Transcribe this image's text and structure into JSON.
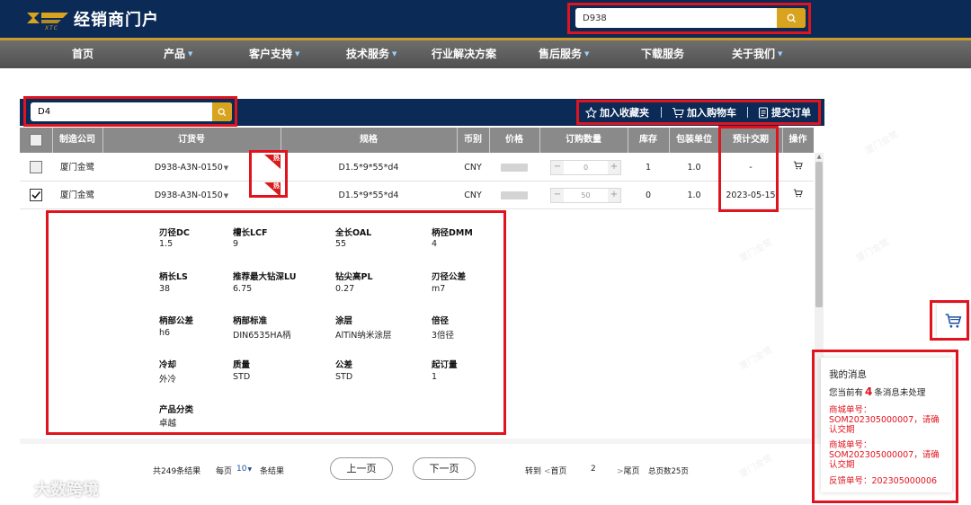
{
  "header": {
    "logo_text": "XTC",
    "portal_title": "经销商门户",
    "search_value": "D938",
    "search_icon": "search-icon"
  },
  "nav": [
    {
      "label": "首页",
      "dropdown": false
    },
    {
      "label": "产品",
      "dropdown": true
    },
    {
      "label": "客户支持",
      "dropdown": true
    },
    {
      "label": "技术服务",
      "dropdown": true
    },
    {
      "label": "行业解决方案",
      "dropdown": false
    },
    {
      "label": "售后服务",
      "dropdown": true
    },
    {
      "label": "下载服务",
      "dropdown": false
    },
    {
      "label": "关于我们",
      "dropdown": true
    }
  ],
  "panel": {
    "code_search_value": "D4",
    "actions": {
      "favorite": "加入收藏夹",
      "cart": "加入购物车",
      "submit": "提交订单"
    }
  },
  "table": {
    "columns": [
      "制造公司",
      "订货号",
      "规格",
      "币别",
      "价格",
      "订购数量",
      "库存",
      "包装单位",
      "预计交期",
      "操作"
    ],
    "rows": [
      {
        "checked": false,
        "maker": "厦门金鹭",
        "order_no": "D938-A3N-0150",
        "spec": "D1.5*9*55*d4",
        "currency": "CNY",
        "qty": "0",
        "stock": "1",
        "pack": "1.0",
        "delivery": "-",
        "flag": "热"
      },
      {
        "checked": true,
        "maker": "厦门金鹭",
        "order_no": "D938-A3N-0150",
        "spec": "D1.5*9*55*d4",
        "currency": "CNY",
        "qty": "50",
        "stock": "0",
        "pack": "1.0",
        "delivery": "2023-05-15",
        "flag": "热"
      }
    ]
  },
  "detail": {
    "specs": [
      {
        "name": "刃径DC",
        "value": "1.5"
      },
      {
        "name": "槽长LCF",
        "value": "9"
      },
      {
        "name": "全长OAL",
        "value": "55"
      },
      {
        "name": "柄径DMM",
        "value": "4"
      },
      {
        "name": "柄长LS",
        "value": "38"
      },
      {
        "name": "推荐最大钻深LU",
        "value": "6.75"
      },
      {
        "name": "钻尖高PL",
        "value": "0.27"
      },
      {
        "name": "刃径公差",
        "value": "m7"
      },
      {
        "name": "柄部公差",
        "value": "h6"
      },
      {
        "name": "柄部标准",
        "value": "DIN6535HA柄"
      },
      {
        "name": "涂层",
        "value": "AlTiN纳米涂层"
      },
      {
        "name": "倍径",
        "value": "3倍径"
      },
      {
        "name": "冷却",
        "value": "外冷"
      },
      {
        "name": "质量",
        "value": "STD"
      },
      {
        "name": "公差",
        "value": "STD"
      },
      {
        "name": "起订量",
        "value": "1"
      },
      {
        "name": "产品分类",
        "value": "卓越"
      }
    ]
  },
  "pager": {
    "total": "共249条结果",
    "per_page_label": "每页",
    "per_page_value": "10",
    "per_page_suffix": "条结果",
    "prev": "上一页",
    "next": "下一页",
    "goto": "转到",
    "first": "首页",
    "current": "2",
    "last": "尾页",
    "total_pages": "总页数25页"
  },
  "messages": {
    "title": "我的消息",
    "count_prefix": "您当前有",
    "count": "4",
    "count_suffix": "条消息未处理",
    "items": [
      "商城单号：SOM202305000007，请确认交期",
      "商城单号：SOM202305000007，请确认交期",
      "反馈单号：202305000006"
    ]
  },
  "watermark": {
    "text": "大数跨境",
    "bg_text": "厦门金鹭"
  },
  "colors": {
    "header_bg": "#0b2a56",
    "accent_gold": "#d8a31e",
    "highlight_red": "#e0141e"
  }
}
